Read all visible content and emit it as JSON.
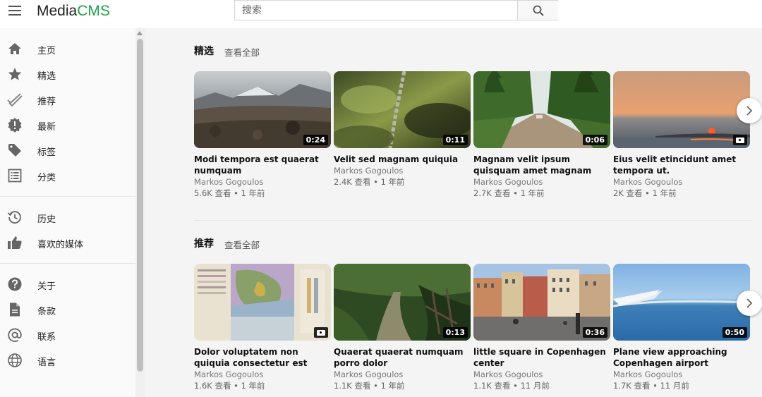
{
  "header": {
    "logo_part1": "Media",
    "logo_part2": "CMS",
    "search_placeholder": "搜索"
  },
  "sidebar": {
    "items": [
      {
        "label": "主页",
        "icon": "home-icon"
      },
      {
        "label": "精选",
        "icon": "star-icon"
      },
      {
        "label": "推荐",
        "icon": "checkmark-icon"
      },
      {
        "label": "最新",
        "icon": "new-badge-icon"
      },
      {
        "label": "标签",
        "icon": "tag-icon"
      },
      {
        "label": "分类",
        "icon": "list-icon"
      },
      {
        "label": "历史",
        "icon": "history-icon"
      },
      {
        "label": "喜欢的媒体",
        "icon": "thumbs-up-icon"
      },
      {
        "label": "关于",
        "icon": "help-icon"
      },
      {
        "label": "条款",
        "icon": "document-icon"
      },
      {
        "label": "联系",
        "icon": "at-icon"
      },
      {
        "label": "语言",
        "icon": "globe-icon"
      }
    ]
  },
  "sections": [
    {
      "title": "精选",
      "view_all": "查看全部",
      "items": [
        {
          "title": "Modi tempora est quaerat numquam",
          "author": "Markos Gogoulos",
          "meta": "5.6K 查看 • 1 年前",
          "duration": "0:24"
        },
        {
          "title": "Velit sed magnam quiquia amet.",
          "author": "Markos Gogoulos",
          "meta": "2.4K 查看 • 1 年前",
          "duration": "0:11"
        },
        {
          "title": "Magnam velit ipsum quisquam amet magnam etincidunt.",
          "author": "Markos Gogoulos",
          "meta": "2.7K 查看 • 1 年前",
          "duration": "0:06"
        },
        {
          "title": "Eius velit etincidunt amet tempora ut.",
          "author": "Markos Gogoulos",
          "meta": "2K 查看 • 1 年前",
          "duration": ""
        }
      ]
    },
    {
      "title": "推荐",
      "view_all": "查看全部",
      "items": [
        {
          "title": "Dolor voluptatem non quiquia consectetur est numquam sed.",
          "author": "Markos Gogoulos",
          "meta": "1.6K 查看 • 1 年前",
          "duration": ""
        },
        {
          "title": "Quaerat quaerat numquam porro dolor",
          "author": "Markos Gogoulos",
          "meta": "1.1K 查看 • 1 年前",
          "duration": "0:13"
        },
        {
          "title": "little square in Copenhagen center",
          "author": "Markos Gogoulos",
          "meta": "1.1K 查看 • 11 月前",
          "duration": "0:36"
        },
        {
          "title": "Plane view approaching Copenhagen airport",
          "author": "Markos Gogoulos",
          "meta": "1.7K 查看 • 11 月前",
          "duration": "0:50"
        }
      ]
    }
  ]
}
